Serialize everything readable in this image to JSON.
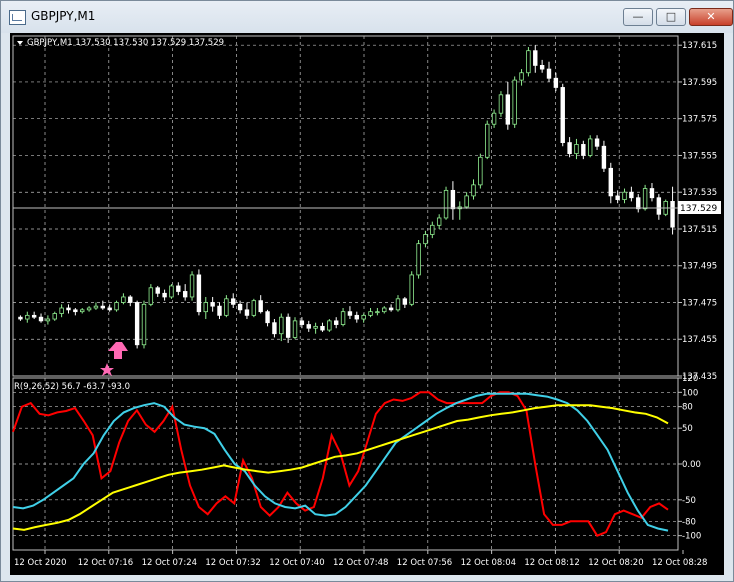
{
  "window": {
    "title": "GBPJPY,M1",
    "minimize_icon": "minimize-icon",
    "maximize_icon": "maximize-icon",
    "close_icon": "close-icon"
  },
  "main_chart": {
    "header": "GBPJPY,M1  137.530 137.530 137.529 137.529",
    "price_ticks": [
      "137.615",
      "137.595",
      "137.575",
      "137.555",
      "137.535",
      "137.515",
      "137.495",
      "137.475",
      "137.455",
      "137.435"
    ],
    "current_price": "137.529",
    "colors": {
      "background": "#000000",
      "grid": "#c0c0c0",
      "bull": "#90ee90",
      "bear": "#ffffff",
      "arrow": "#ff69b4",
      "price_line": "#c0c0c0"
    }
  },
  "indicator": {
    "header": "R(9,26,52) 56.7 -63.7 -93.0",
    "level_ticks": [
      "120",
      "100",
      "80",
      "50",
      "0.00",
      "-50",
      "-80",
      "-100"
    ],
    "colors": {
      "red": "#ff0000",
      "cyan": "#40d0e8",
      "yellow": "#ffff00"
    }
  },
  "time_axis": [
    "12 Oct 2020",
    "12 Oct 07:16",
    "12 Oct 07:24",
    "12 Oct 07:32",
    "12 Oct 07:40",
    "12 Oct 07:48",
    "12 Oct 07:56",
    "12 Oct 08:04",
    "12 Oct 08:12",
    "12 Oct 08:20",
    "12 Oct 08:28"
  ],
  "chart_data": {
    "type": "candlestick",
    "symbol": "GBPJPY",
    "timeframe": "M1",
    "ylim": [
      137.435,
      137.62
    ],
    "candles": [
      [
        137.467,
        137.468,
        137.465,
        137.466
      ],
      [
        137.466,
        137.47,
        137.464,
        137.468
      ],
      [
        137.468,
        137.47,
        137.466,
        137.467
      ],
      [
        137.467,
        137.469,
        137.464,
        137.465
      ],
      [
        137.465,
        137.468,
        137.463,
        137.466
      ],
      [
        137.466,
        137.47,
        137.465,
        137.469
      ],
      [
        137.469,
        137.474,
        137.467,
        137.472
      ],
      [
        137.472,
        137.474,
        137.469,
        137.471
      ],
      [
        137.471,
        137.472,
        137.468,
        137.47
      ],
      [
        137.47,
        137.472,
        137.469,
        137.471
      ],
      [
        137.471,
        137.473,
        137.47,
        137.472
      ],
      [
        137.472,
        137.475,
        137.471,
        137.473
      ],
      [
        137.473,
        137.476,
        137.471,
        137.472
      ],
      [
        137.472,
        137.474,
        137.47,
        137.471
      ],
      [
        137.471,
        137.476,
        137.47,
        137.475
      ],
      [
        137.475,
        137.48,
        137.474,
        137.478
      ],
      [
        137.478,
        137.479,
        137.473,
        137.475
      ],
      [
        137.475,
        137.476,
        137.45,
        137.452
      ],
      [
        137.452,
        137.476,
        137.45,
        137.474
      ],
      [
        137.474,
        137.485,
        137.473,
        137.483
      ],
      [
        137.483,
        137.484,
        137.478,
        137.48
      ],
      [
        137.48,
        137.482,
        137.476,
        137.478
      ],
      [
        137.478,
        137.485,
        137.477,
        137.484
      ],
      [
        137.484,
        137.486,
        137.479,
        137.481
      ],
      [
        137.481,
        137.485,
        137.476,
        137.478
      ],
      [
        137.478,
        137.492,
        137.476,
        137.49
      ],
      [
        137.49,
        137.493,
        137.468,
        137.47
      ],
      [
        137.47,
        137.478,
        137.466,
        137.475
      ],
      [
        137.475,
        137.478,
        137.47,
        137.473
      ],
      [
        137.473,
        137.475,
        137.466,
        137.468
      ],
      [
        137.468,
        137.479,
        137.467,
        137.477
      ],
      [
        137.477,
        137.48,
        137.472,
        137.474
      ],
      [
        137.474,
        137.476,
        137.469,
        137.471
      ],
      [
        137.471,
        137.475,
        137.466,
        137.468
      ],
      [
        137.468,
        137.477,
        137.467,
        137.476
      ],
      [
        137.476,
        137.479,
        137.469,
        137.47
      ],
      [
        137.47,
        137.471,
        137.462,
        137.464
      ],
      [
        137.464,
        137.466,
        137.456,
        137.458
      ],
      [
        137.458,
        137.469,
        137.454,
        137.467
      ],
      [
        137.467,
        137.469,
        137.453,
        137.456
      ],
      [
        137.456,
        137.467,
        137.455,
        137.465
      ],
      [
        137.465,
        137.467,
        137.461,
        137.463
      ],
      [
        137.463,
        137.465,
        137.459,
        137.461
      ],
      [
        137.461,
        137.464,
        137.458,
        137.462
      ],
      [
        137.462,
        137.464,
        137.459,
        137.46
      ],
      [
        137.46,
        137.466,
        137.459,
        137.465
      ],
      [
        137.465,
        137.467,
        137.461,
        137.463
      ],
      [
        137.463,
        137.472,
        137.462,
        137.47
      ],
      [
        137.47,
        137.473,
        137.466,
        137.468
      ],
      [
        137.468,
        137.47,
        137.464,
        137.466
      ],
      [
        137.466,
        137.469,
        137.464,
        137.468
      ],
      [
        137.468,
        137.472,
        137.467,
        137.47
      ],
      [
        137.47,
        137.472,
        137.468,
        137.47
      ],
      [
        137.47,
        137.473,
        137.469,
        137.472
      ],
      [
        137.472,
        137.474,
        137.47,
        137.471
      ],
      [
        137.471,
        137.479,
        137.47,
        137.477
      ],
      [
        137.477,
        137.478,
        137.472,
        137.474
      ],
      [
        137.474,
        137.492,
        137.473,
        137.49
      ],
      [
        137.49,
        137.509,
        137.488,
        137.507
      ],
      [
        137.507,
        137.514,
        137.505,
        137.512
      ],
      [
        137.512,
        137.519,
        137.51,
        137.517
      ],
      [
        137.517,
        137.523,
        137.515,
        137.521
      ],
      [
        137.521,
        137.538,
        137.52,
        137.536
      ],
      [
        137.536,
        137.541,
        137.52,
        137.526
      ],
      [
        137.526,
        137.53,
        137.52,
        137.527
      ],
      [
        137.527,
        137.535,
        137.526,
        137.533
      ],
      [
        137.533,
        137.542,
        137.531,
        137.539
      ],
      [
        137.539,
        137.556,
        137.537,
        137.554
      ],
      [
        137.554,
        137.574,
        137.553,
        137.572
      ],
      [
        137.572,
        137.58,
        137.57,
        137.578
      ],
      [
        137.578,
        137.59,
        137.576,
        137.588
      ],
      [
        137.588,
        137.595,
        137.569,
        137.572
      ],
      [
        137.572,
        137.598,
        137.57,
        137.596
      ],
      [
        137.596,
        137.602,
        137.593,
        137.6
      ],
      [
        137.6,
        137.614,
        137.598,
        137.612
      ],
      [
        137.612,
        137.615,
        137.6,
        137.604
      ],
      [
        137.604,
        137.607,
        137.6,
        137.602
      ],
      [
        137.602,
        137.606,
        137.595,
        137.597
      ],
      [
        137.597,
        137.6,
        137.59,
        137.592
      ],
      [
        137.592,
        137.594,
        137.56,
        137.562
      ],
      [
        137.562,
        137.565,
        137.554,
        137.556
      ],
      [
        137.556,
        137.564,
        137.553,
        137.561
      ],
      [
        137.561,
        137.563,
        137.553,
        137.555
      ],
      [
        137.555,
        137.566,
        137.554,
        137.564
      ],
      [
        137.564,
        137.566,
        137.558,
        137.56
      ],
      [
        137.56,
        137.563,
        137.546,
        137.548
      ],
      [
        137.548,
        137.551,
        137.529,
        137.533
      ],
      [
        137.533,
        137.536,
        137.529,
        137.531
      ],
      [
        137.531,
        137.537,
        137.529,
        137.535
      ],
      [
        137.535,
        137.538,
        137.53,
        137.532
      ],
      [
        137.532,
        137.534,
        137.524,
        137.526
      ],
      [
        137.526,
        137.539,
        137.525,
        137.537
      ],
      [
        137.537,
        137.54,
        137.53,
        137.532
      ],
      [
        137.532,
        137.534,
        137.52,
        137.523
      ],
      [
        137.523,
        137.531,
        137.522,
        137.53
      ],
      [
        137.53,
        137.538,
        137.512,
        137.516
      ]
    ],
    "indicator": {
      "name": "R(9,26,52)",
      "ylim": [
        -120,
        120
      ],
      "levels": [
        100,
        80,
        50,
        0,
        -50,
        -80,
        -100
      ],
      "series": [
        {
          "name": "R(9)",
          "color": "#ff0000",
          "values": [
            45,
            80,
            85,
            70,
            68,
            72,
            74,
            78,
            60,
            40,
            -20,
            -10,
            30,
            60,
            75,
            55,
            45,
            60,
            80,
            20,
            -30,
            -60,
            -70,
            -55,
            -45,
            -55,
            5,
            -20,
            -60,
            -72,
            -60,
            -40,
            -55,
            -65,
            -60,
            -20,
            40,
            15,
            -30,
            -10,
            30,
            70,
            85,
            90,
            88,
            92,
            100,
            100,
            90,
            85,
            85,
            85,
            85,
            85,
            95,
            100,
            100,
            95,
            75,
            0,
            -70,
            -85,
            -85,
            -80,
            -80,
            -80,
            -100,
            -95,
            -70,
            -65,
            -70,
            -75,
            -60,
            -55,
            -63.7
          ]
        },
        {
          "name": "R(26)",
          "color": "#40d0e8",
          "values": [
            -60,
            -62,
            -58,
            -50,
            -40,
            -30,
            -20,
            0,
            15,
            40,
            60,
            72,
            78,
            82,
            85,
            80,
            65,
            55,
            52,
            50,
            42,
            20,
            0,
            -10,
            -30,
            -45,
            -55,
            -60,
            -62,
            -58,
            -70,
            -72,
            -70,
            -60,
            -45,
            -30,
            -10,
            10,
            30,
            40,
            50,
            60,
            70,
            78,
            85,
            90,
            95,
            98,
            98,
            98,
            98,
            98,
            96,
            94,
            90,
            85,
            75,
            60,
            40,
            20,
            -10,
            -40,
            -65,
            -85,
            -90,
            -93
          ]
        },
        {
          "name": "R(52)",
          "color": "#ffff00",
          "values": [
            -90,
            -92,
            -88,
            -85,
            -82,
            -78,
            -70,
            -60,
            -50,
            -40,
            -35,
            -30,
            -25,
            -20,
            -15,
            -12,
            -10,
            -8,
            -5,
            -2,
            -5,
            -8,
            -10,
            -12,
            -10,
            -8,
            -5,
            0,
            5,
            10,
            12,
            15,
            20,
            25,
            30,
            35,
            40,
            45,
            50,
            55,
            60,
            62,
            65,
            68,
            70,
            72,
            75,
            78,
            80,
            82,
            82,
            82,
            82,
            80,
            78,
            75,
            72,
            70,
            65,
            56.7
          ]
        }
      ]
    }
  }
}
